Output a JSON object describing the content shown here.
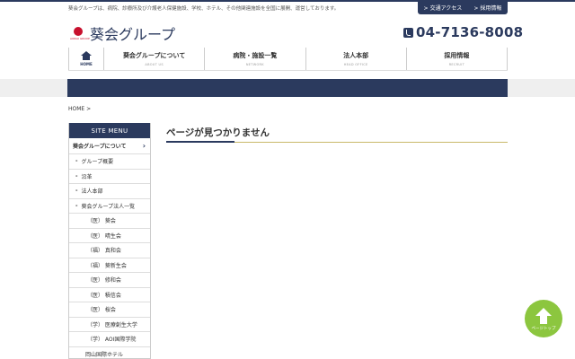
{
  "header": {
    "tagline": "葵会グループは、病院、診療所及び介護老人保健施設、学校、ホテル、その他関連施設を全国に展開、運営しております。",
    "top_links": [
      {
        "label": "交通アクセス"
      },
      {
        "label": "採用情報"
      }
    ],
    "logo_text": "葵会グループ",
    "logo_sub": "AOIKAI GROUP",
    "phone": "04-7136-8008"
  },
  "gnav": {
    "home": "HOME",
    "items": [
      {
        "jp": "葵会グループについて",
        "en": "ABOUT US"
      },
      {
        "jp": "病院・施設一覧",
        "en": "NETWORK"
      },
      {
        "jp": "法人本部",
        "en": "HEAD OFFICE"
      },
      {
        "jp": "採用情報",
        "en": "RECRUIT"
      }
    ]
  },
  "breadcrumb": "HOME >",
  "sidemenu": {
    "title": "SITE MENU",
    "items": [
      {
        "label": "葵会グループについて"
      },
      {
        "label": "グループ概要"
      },
      {
        "label": "沿革"
      },
      {
        "label": "法人本部"
      },
      {
        "label": "葵会グループ法人一覧"
      },
      {
        "label": "（医） 葵会"
      },
      {
        "label": "（医） 晴生会"
      },
      {
        "label": "（福） 真和会"
      },
      {
        "label": "（福） 葵新生会"
      },
      {
        "label": "（医） 修和会"
      },
      {
        "label": "（医） 積信会"
      },
      {
        "label": "（医） 桜会"
      },
      {
        "label": "（学） 医療創生大学"
      },
      {
        "label": "（学） AOI国際学院"
      },
      {
        "label": "岡山国際ホテル"
      }
    ]
  },
  "main": {
    "title": "ページが見つかりません"
  },
  "pagetop": {
    "label": "ページトップ"
  },
  "colors": {
    "navy": "#2b3a5e",
    "accent_red": "#c8102e",
    "pagetop_green": "#8cc63f",
    "title_underline": "#c9b96a"
  }
}
